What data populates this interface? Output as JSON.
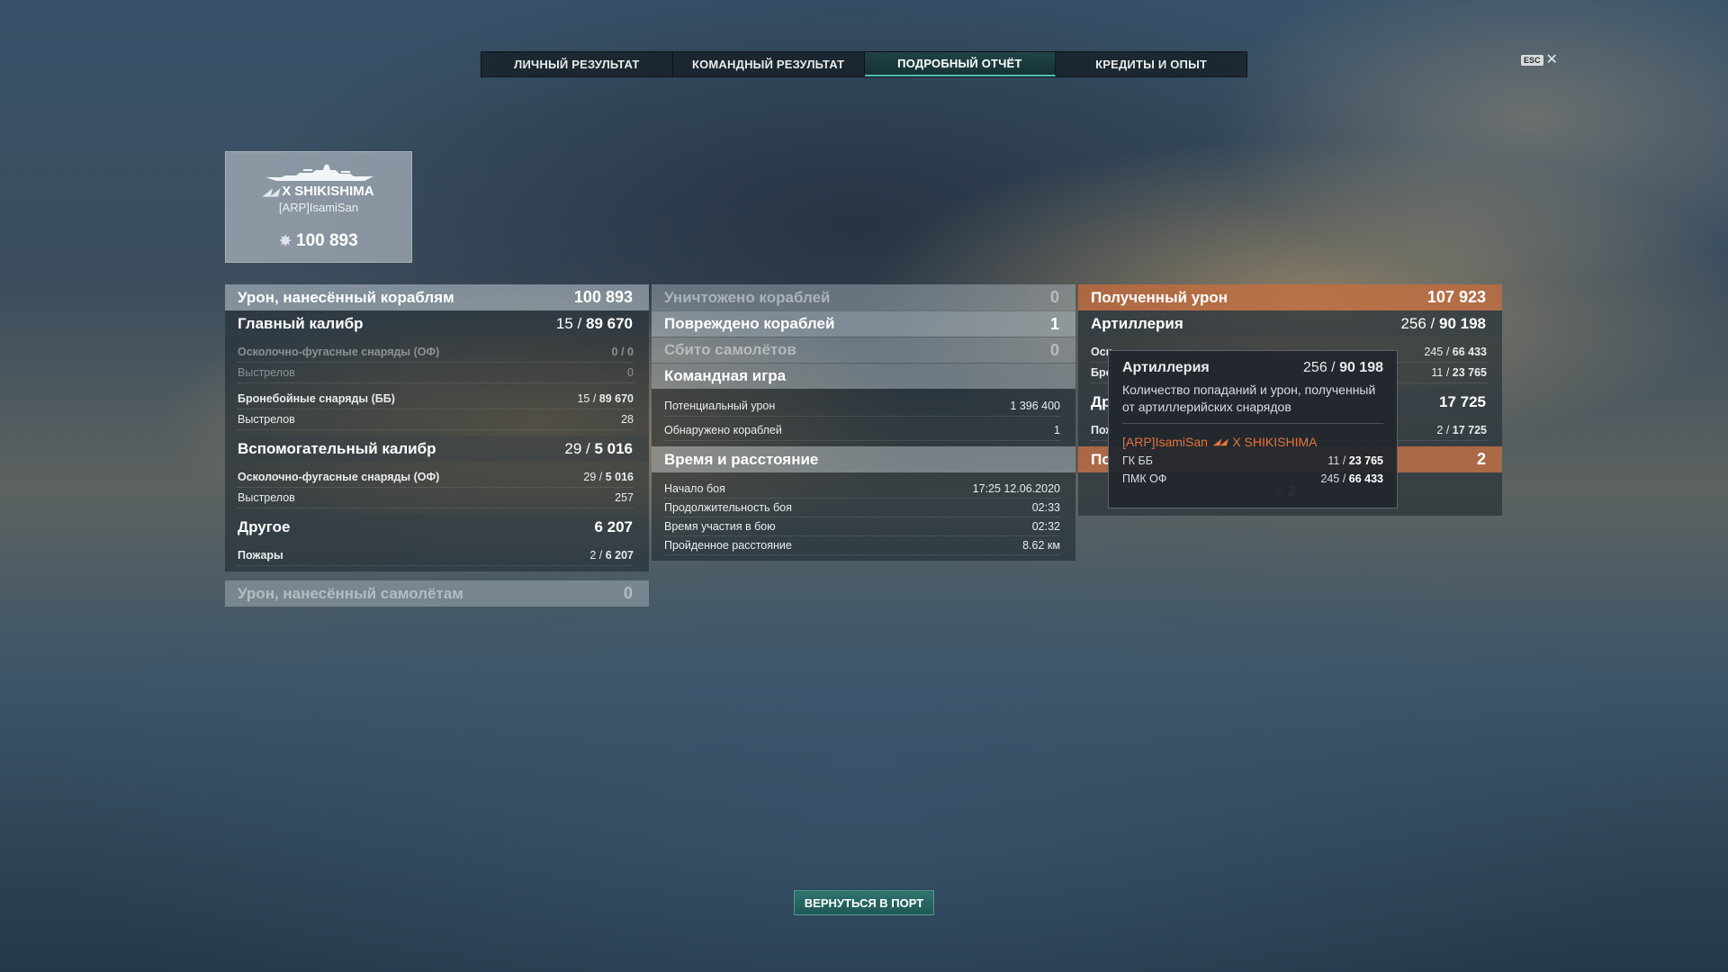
{
  "tabs": [
    "ЛИЧНЫЙ РЕЗУЛЬТАТ",
    "КОМАНДНЫЙ РЕЗУЛЬТАТ",
    "ПОДРОБНЫЙ ОТЧЁТ",
    "КРЕДИТЫ И ОПЫТ"
  ],
  "active_tab": "ПОДРОБНЫЙ ОТЧЁТ",
  "esc_label": "ESC",
  "ship": {
    "tier": "X",
    "name": "SHIKISHIMA",
    "player": "[ARP]IsamiSan",
    "damage": "100 893"
  },
  "left": {
    "damage_ships": {
      "label": "Урон, нанесённый кораблям",
      "value": "100 893"
    },
    "main": {
      "label": "Главный калибр",
      "hits": "15",
      "dmg": "89 670",
      "he": {
        "label": "Осколочно-фугасные снаряды (ОФ)",
        "value": "0 / 0"
      },
      "he_shots": {
        "label": "Выстрелов",
        "value": "0"
      },
      "ap": {
        "label": "Бронебойные снаряды (ББ)",
        "hits": "15",
        "dmg": "89 670"
      },
      "ap_shots": {
        "label": "Выстрелов",
        "value": "28"
      }
    },
    "secondary": {
      "label": "Вспомогательный калибр",
      "hits": "29",
      "dmg": "5 016",
      "he": {
        "label": "Осколочно-фугасные снаряды (ОФ)",
        "hits": "29",
        "dmg": "5 016"
      },
      "he_shots": {
        "label": "Выстрелов",
        "value": "257"
      }
    },
    "other": {
      "label": "Другое",
      "value": "6 207",
      "fires": {
        "label": "Пожары",
        "hits": "2",
        "dmg": "6 207"
      }
    },
    "damage_planes": {
      "label": "Урон, нанесённый самолётам",
      "value": "0"
    }
  },
  "middle": {
    "destroyed": {
      "label": "Уничтожено кораблей",
      "value": "0"
    },
    "damaged": {
      "label": "Повреждено кораблей",
      "value": "1"
    },
    "planes": {
      "label": "Сбито самолётов",
      "value": "0"
    },
    "team": {
      "label": "Командная игра",
      "potential": {
        "label": "Потенциальный урон",
        "value": "1 396 400"
      },
      "spotted": {
        "label": "Обнаружено кораблей",
        "value": "1"
      }
    },
    "time": {
      "label": "Время и расстояние",
      "start": {
        "label": "Начало боя",
        "value": "17:25  12.06.2020"
      },
      "duration": {
        "label": "Продолжительность боя",
        "value": "02:33"
      },
      "participation": {
        "label": "Время участия в бою",
        "value": "02:32"
      },
      "distance": {
        "label": "Пройденное расстояние",
        "value": "8.62 км"
      }
    }
  },
  "right": {
    "received": {
      "label": "Полученный урон",
      "value": "107 923"
    },
    "artillery": {
      "label": "Артиллерия",
      "hits": "256",
      "dmg": "90 198"
    },
    "art_line1": {
      "label": "Оск",
      "hits": "245",
      "dmg": "66 433"
    },
    "art_line2": {
      "label": "Бро",
      "hits": "11",
      "dmg": "23 765"
    },
    "other": {
      "label": "Др",
      "value": "17 725"
    },
    "other_line": {
      "label": "Пож",
      "hits": "2",
      "dmg": "17 725"
    },
    "potential": {
      "label": "По",
      "value": "2"
    },
    "kills": "2"
  },
  "tooltip": {
    "title": "Артиллерия",
    "hits": "256",
    "dmg": "90 198",
    "desc": "Количество попаданий и урон, полученный от артиллерийских снарядов",
    "player": "[ARP]IsamiSan",
    "ship": "X SHIKISHIMA",
    "line1": {
      "label": "ГК ББ",
      "hits": "11",
      "dmg": "23 765"
    },
    "line2": {
      "label": "ПМК ОФ",
      "hits": "245",
      "dmg": "66 433"
    }
  },
  "button": "ВЕРНУТЬСЯ В ПОРТ",
  "colors": {
    "accent": "#4fbfb5",
    "enemy": "#e8733a",
    "received_header": "#cd6e3c"
  }
}
